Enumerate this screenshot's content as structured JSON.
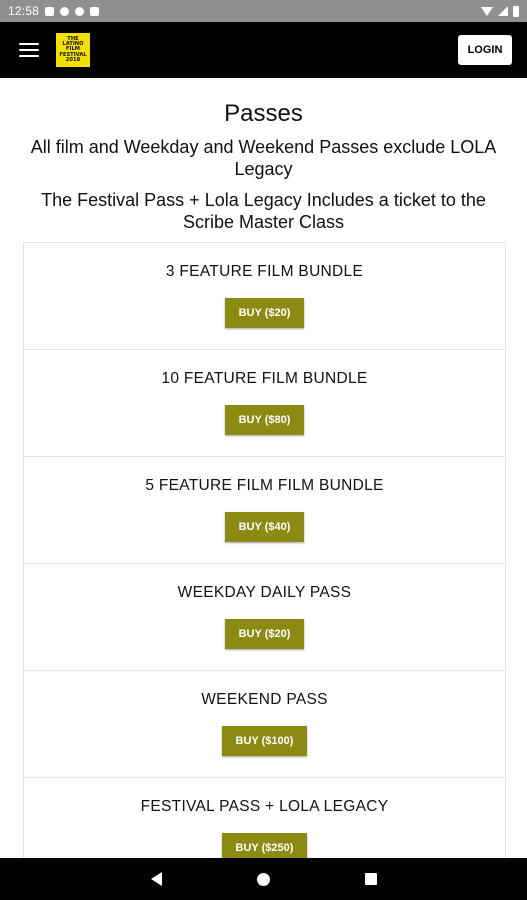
{
  "status_bar": {
    "time": "12:58",
    "left_icons": [
      "mail-icon",
      "sync-icon",
      "app-icon",
      "sim-icon"
    ],
    "right_icons": [
      "wifi-icon",
      "signal-icon",
      "battery-icon"
    ]
  },
  "header": {
    "logo_lines": [
      "THE",
      "LATINO",
      "FILM",
      "FESTIVAL",
      "2018"
    ],
    "login_label": "LOGIN",
    "background": "#000000",
    "logo_color": "#f1e000"
  },
  "main": {
    "title": "Passes",
    "subtitle_1": "All film and Weekday and Weekend Passes exclude LOLA Legacy",
    "subtitle_2": "The Festival Pass + Lola Legacy Includes a ticket to the Scribe Master Class",
    "passes": [
      {
        "name": "3 FEATURE FILM BUNDLE",
        "buy_label": "BUY ($20)"
      },
      {
        "name": "10 FEATURE FILM BUNDLE",
        "buy_label": "BUY ($80)"
      },
      {
        "name": "5 FEATURE FILM FILM BUNDLE",
        "buy_label": "BUY ($40)"
      },
      {
        "name": "WEEKDAY DAILY PASS",
        "buy_label": "BUY ($20)"
      },
      {
        "name": "WEEKEND PASS",
        "buy_label": "BUY ($100)"
      },
      {
        "name": "FESTIVAL PASS + LOLA LEGACY",
        "buy_label": "BUY ($250)"
      }
    ],
    "button_color": "#8b8b13"
  },
  "nav_bar": {
    "icons": [
      "back-icon",
      "home-icon",
      "recents-icon"
    ]
  }
}
